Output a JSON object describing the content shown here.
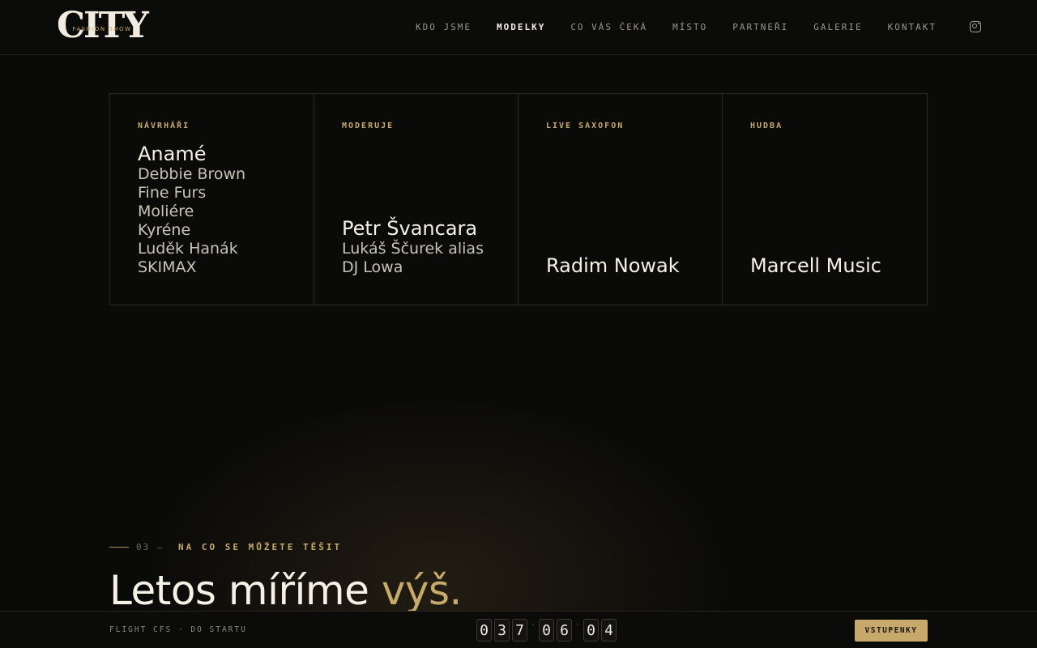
{
  "header": {
    "logo_main": "CITY",
    "logo_sub": "FASHION SHOW",
    "nav": [
      {
        "label": "KDO JSME",
        "active": false
      },
      {
        "label": "MODELKY",
        "active": true
      },
      {
        "label": "CO VÁS ČEKÁ",
        "active": false
      },
      {
        "label": "MÍSTO",
        "active": false
      },
      {
        "label": "PARTNEŘI",
        "active": false
      },
      {
        "label": "GALERIE",
        "active": false
      },
      {
        "label": "KONTAKT",
        "active": false
      }
    ],
    "instagram_icon": "instagram-icon"
  },
  "lineup": [
    {
      "label": "NÁVRHÁŘI",
      "main": "Anamé",
      "subs": [
        "Debbie Brown",
        "Fine Furs",
        "Moliére",
        "Kyréne",
        "Luděk Hanák",
        "SKIMAX"
      ]
    },
    {
      "label": "MODERUJE",
      "main": "Petr Švancara",
      "subs": [
        "Lukáš Ščurek alias DJ Lowa"
      ]
    },
    {
      "label": "LIVE SAXOFON",
      "main": "Radim Nowak",
      "subs": []
    },
    {
      "label": "HUDBA",
      "main": "Marcell Music",
      "subs": []
    }
  ],
  "section": {
    "number": "03 —",
    "label": "NA CO SE MŮŽETE TĚŠIT",
    "headline_main": "Letos míříme",
    "headline_accent": "výš."
  },
  "bottom_bar": {
    "label": "FLIGHT CFS · DO STARTU",
    "countdown": {
      "days": "037",
      "hours": "06",
      "minutes": "04"
    },
    "tickets_label": "VSTUPENKY"
  },
  "colors": {
    "accent": "#c7a96b",
    "background": "#0a0a09",
    "text": "#f6f1e6"
  }
}
